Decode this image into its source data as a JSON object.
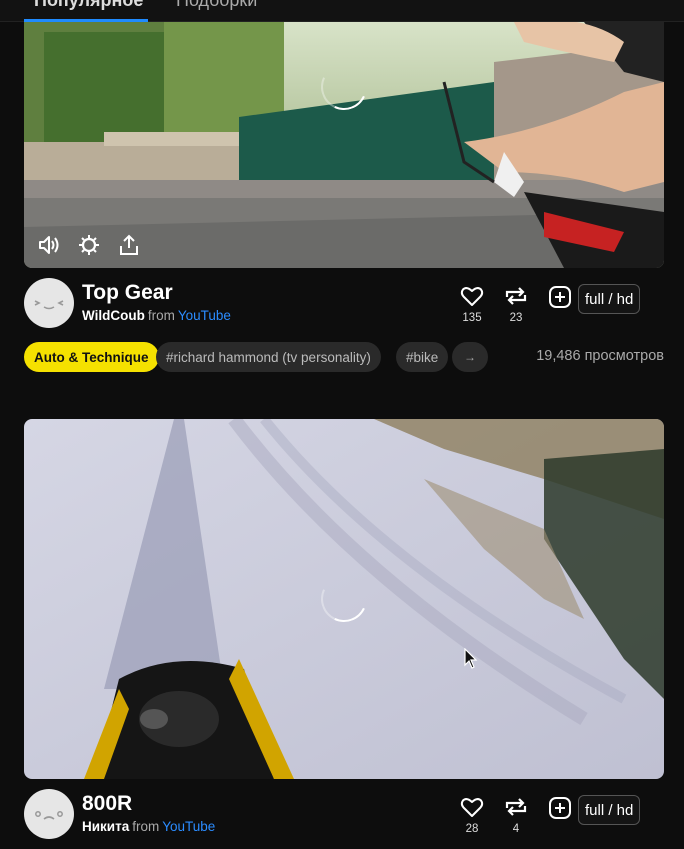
{
  "topbar": {
    "tab_active": "Популярное",
    "tab_other": "Подборки"
  },
  "coubs": [
    {
      "title": "Top Gear",
      "author": "WildCoub",
      "from_label": "from",
      "source": "YouTube",
      "likes": "135",
      "recoubs": "23",
      "quality": "full / hd",
      "category": "Auto & Technique",
      "tags": [
        "#richard hammond (tv personality)",
        "#bike"
      ],
      "more_label": "→",
      "views": "19,486 просмотров",
      "controls": [
        "volume-icon",
        "brightness-icon",
        "share-icon"
      ]
    },
    {
      "title": "800R",
      "author": "Никита",
      "from_label": "from",
      "source": "YouTube",
      "likes": "28",
      "recoubs": "4",
      "quality": "full / hd"
    }
  ],
  "colors": {
    "accent_blue": "#1f8bff",
    "category_yellow": "#f5e100",
    "background": "#0d0d0d"
  }
}
